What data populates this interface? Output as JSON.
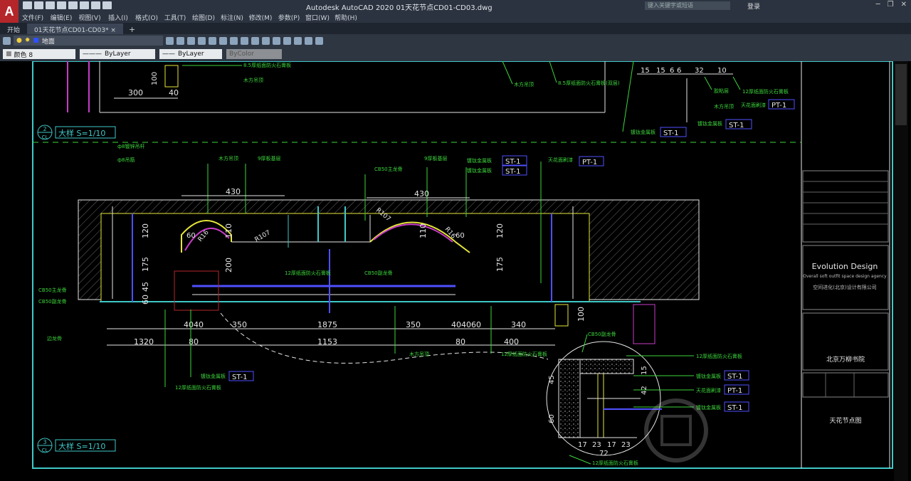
{
  "app": {
    "logo": "A",
    "window_title": "Autodesk AutoCAD 2020    01天花节点CD01-CD03.dwg",
    "search_placeholder": "键入关键字或短语",
    "login_label": "登录"
  },
  "menu": [
    "文件(F)",
    "编辑(E)",
    "视图(V)",
    "插入(I)",
    "格式(O)",
    "工具(T)",
    "绘图(D)",
    "标注(N)",
    "修改(M)",
    "参数(P)",
    "窗口(W)",
    "帮助(H)"
  ],
  "tabs": [
    {
      "label": "开始"
    },
    {
      "label": "01天花节点CD01-CD03*  ×"
    }
  ],
  "toolbar": {
    "layer_value": "地面",
    "color_value": "颜色 8",
    "linetype_value": "ByLayer",
    "lineweight_value": "ByLayer",
    "plotstyle_value": "ByColor"
  },
  "drawing": {
    "detail2_number": "2",
    "detail2_sheet": "CL",
    "detail2_title": "大样  S=1/10",
    "detail3_number": "3",
    "detail3_sheet": "CL",
    "detail3_title": "大样  S=1/10",
    "dims_top": [
      "300",
      "40",
      "100"
    ],
    "dims_main_top": [
      "430",
      "430"
    ],
    "dims_vert_left": [
      "120",
      "175",
      "60",
      "45",
      "200",
      "110"
    ],
    "dims_bottom_row1": [
      "4040",
      "350",
      "1875",
      "350",
      "4040",
      "60",
      "340"
    ],
    "dims_bottom_row2": [
      "1320",
      "80",
      "1153",
      "80",
      "400"
    ],
    "dims_radius": [
      "R16",
      "R107",
      "R107",
      "R16",
      "60",
      "60"
    ],
    "dims_detail": [
      "17",
      "23",
      "17",
      "23",
      "72",
      "45",
      "42",
      "60",
      "15"
    ],
    "dims_right_top": [
      "15",
      "15",
      "6",
      "6",
      "32",
      "10"
    ],
    "labels_green": {
      "top_stone_1": "8.5厚纸面防火石膏板",
      "top_wood": "木方吊顶",
      "top_wood2": "木方吊顶",
      "top_stone_2": "8.5厚纸面防火石膏板(双层)",
      "rt_glue": "胶粘层",
      "rt_stone": "12厚纸面防火石膏板",
      "rt_wood": "木方吊顶",
      "rt_paint": "天花面刷漆",
      "rt_metal": "镀钛金属板",
      "rt_metal2": "镀钛金属板",
      "rod1": "ф8镀锌吊杆",
      "rod2": "ф8吊筋",
      "wood_frame": "木方吊顶",
      "stone9": "9厚板基层",
      "cb50_main": "CB50主龙骨",
      "stone9b": "9厚板基层",
      "metal_a": "镀钛金属板",
      "metal_b": "镀钛金属板",
      "ceiling_paint": "天花面刷漆",
      "cb50_main_l": "CB50主龙骨",
      "cb50_sub_l": "CB50副龙骨",
      "stone12_mid": "12厚纸面防火石膏板",
      "cb50_sub_mid": "CB50副龙骨",
      "side_keel": "边龙骨",
      "metal_bottom": "镀钛金属板",
      "stone12_bottom": "12厚纸面防火石膏板",
      "wood_bottom": "木方吊顶",
      "stone12_bottom2": "12厚纸面防火石膏板",
      "cb50_sub_d": "CB50副龙骨",
      "stone12_d": "12厚纸面防火石膏板",
      "metal_d": "镀钛金属板",
      "paint_d": "天花面刷漆",
      "metal_d2": "镀钛金属板",
      "stone12_d2": "12厚纸面防火石膏板"
    },
    "tags": {
      "st1_a": "ST-1",
      "st1_b": "ST-1",
      "pt1_a": "PT-1",
      "st1_c": "ST-1",
      "st1_d": "ST-1",
      "pt1_b": "PT-1",
      "st1_e": "ST-1",
      "st1_f": "ST-1",
      "pt1_c": "PT-1",
      "st1_g": "ST-1",
      "st1_h": "ST-1",
      "st1_i": "ST-1"
    },
    "title_block": {
      "company": "Evolution Design",
      "tagline": "Overall soft outfit space design agency",
      "company_cn": "空间进化(北京)设计有限公司",
      "project": "北京万柳书院",
      "sheet_label": "天花节点图"
    }
  },
  "colors": {
    "green": "#3cd63c",
    "cyan": "#40c8c8",
    "yellow": "#e6e63a",
    "magenta": "#c83cc8",
    "white": "#e6e6e6",
    "blue": "#5050ff",
    "hatch": "#707070"
  }
}
